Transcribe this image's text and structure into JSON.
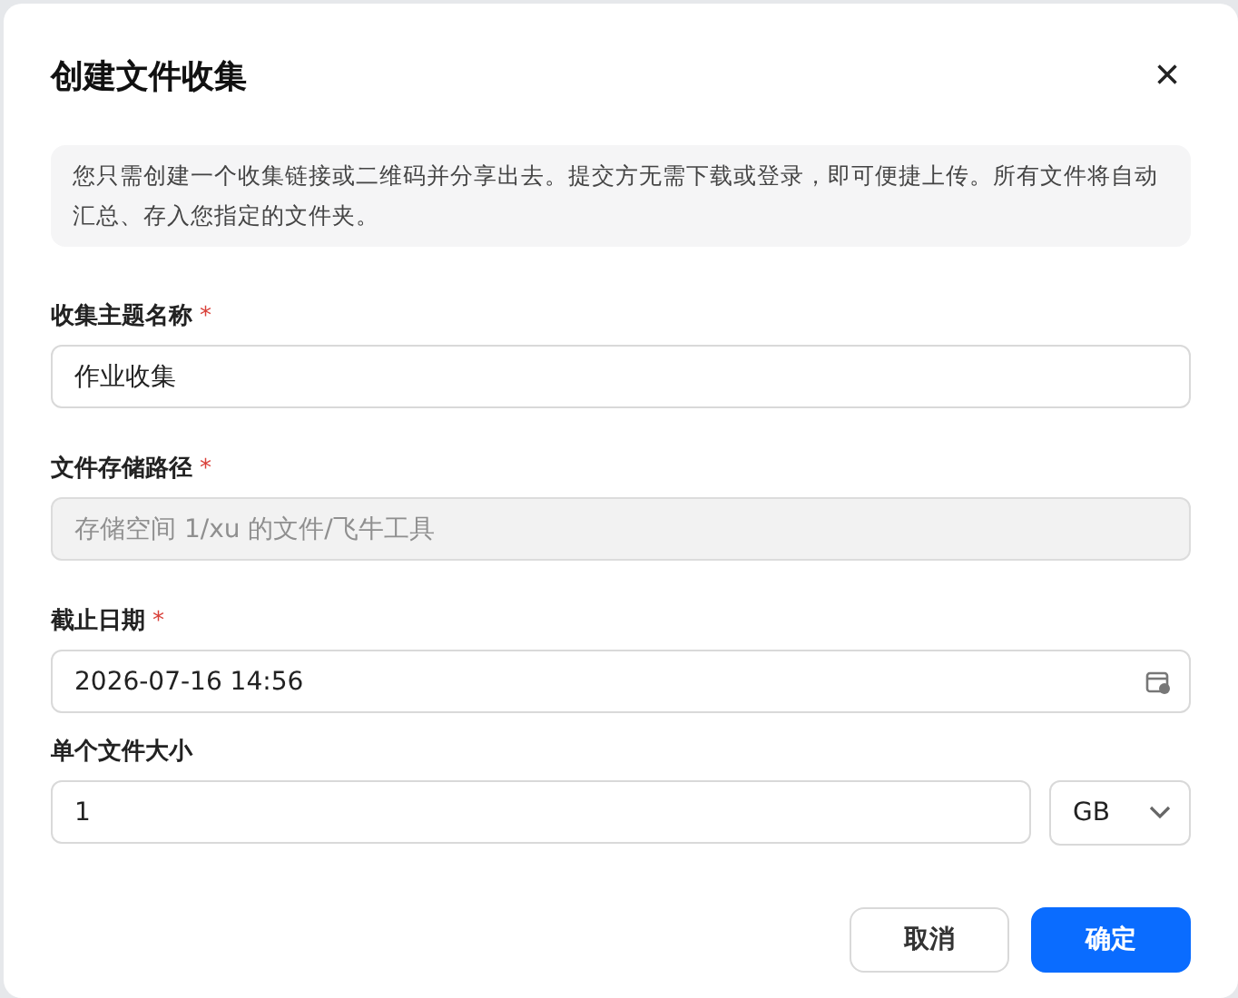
{
  "dialog": {
    "title": "创建文件收集",
    "close": "×"
  },
  "notice": "您只需创建一个收集链接或二维码并分享出去。提交方无需下载或登录，即可便捷上传。所有文件将自动汇总、存入您指定的文件夹。",
  "fields": [
    {
      "kind": "text",
      "label": "收集主题名称",
      "required": true,
      "value": "作业收集",
      "disabled": false
    },
    {
      "kind": "text",
      "label": "文件存储路径",
      "required": true,
      "value": "存储空间 1/xu 的文件/飞牛工具",
      "disabled": true
    },
    {
      "kind": "date",
      "label": "截止日期",
      "required": true,
      "value": "2026-07-16 14:56",
      "disabled": false
    },
    {
      "kind": "size",
      "label": "单个文件大小",
      "required": false,
      "value": "1",
      "unit": "GB",
      "disabled": false
    }
  ],
  "required_mark": "*",
  "buttons": [
    {
      "label": "取消",
      "primary": false
    },
    {
      "label": "确定",
      "primary": true
    }
  ]
}
